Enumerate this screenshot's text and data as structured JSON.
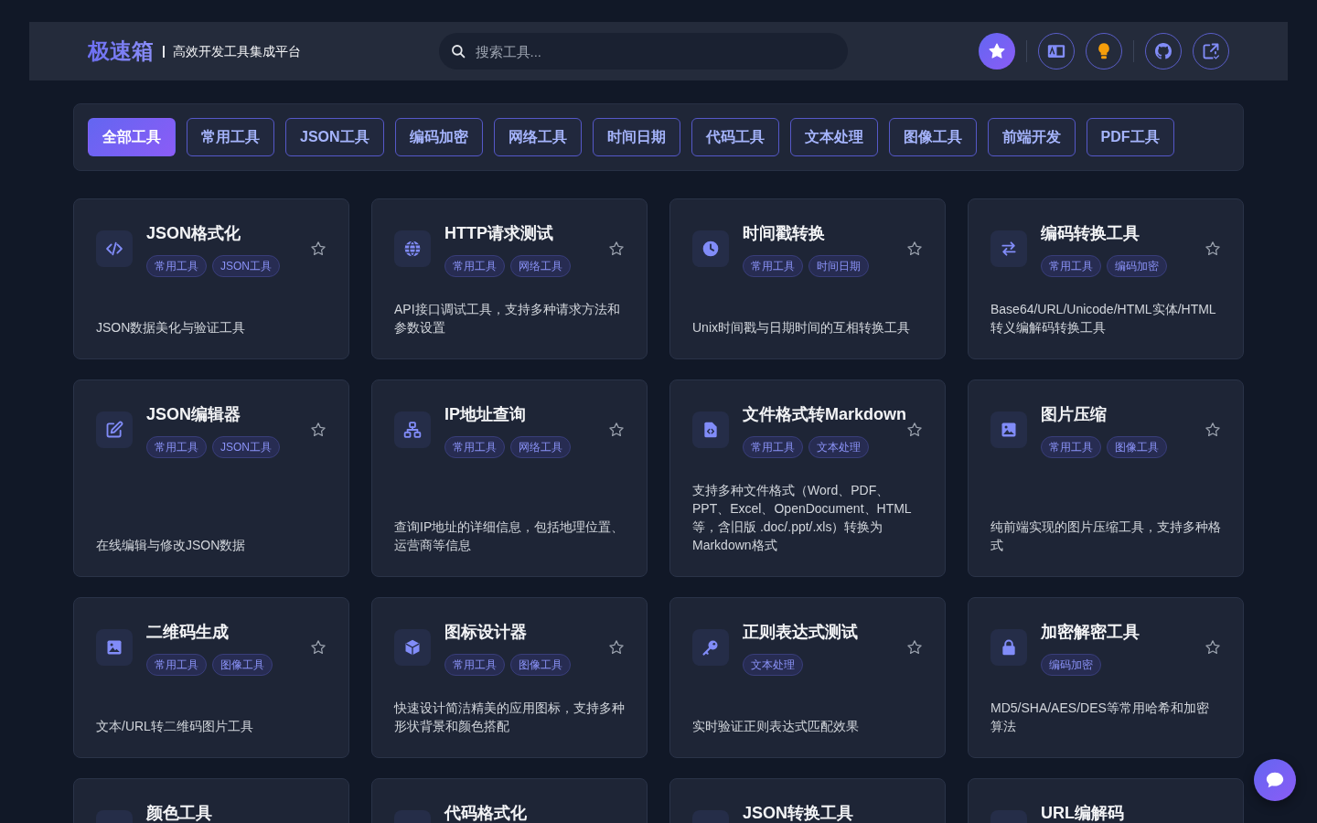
{
  "header": {
    "logo": "极速箱",
    "tagline": "高效开发工具集成平台",
    "search": {
      "placeholder": "搜索工具..."
    },
    "toolbar": [
      {
        "kind": "favorites"
      },
      {
        "kind": "separator"
      },
      {
        "kind": "language"
      },
      {
        "kind": "theme"
      },
      {
        "kind": "separator"
      },
      {
        "kind": "repository"
      },
      {
        "kind": "share"
      }
    ]
  },
  "categories": [
    {
      "label": "全部工具",
      "selected": true
    },
    {
      "label": "常用工具",
      "selected": false
    },
    {
      "label": "JSON工具",
      "selected": false
    },
    {
      "label": "编码加密",
      "selected": false
    },
    {
      "label": "网络工具",
      "selected": false
    },
    {
      "label": "时间日期",
      "selected": false
    },
    {
      "label": "代码工具",
      "selected": false
    },
    {
      "label": "文本处理",
      "selected": false
    },
    {
      "label": "图像工具",
      "selected": false
    },
    {
      "label": "前端开发",
      "selected": false
    },
    {
      "label": "PDF工具",
      "selected": false
    }
  ],
  "tools": [
    {
      "kind": "formatter",
      "title": "JSON格式化",
      "tags": [
        "常用工具",
        "JSON工具"
      ],
      "favorite": false,
      "description": "JSON数据美化与验证工具"
    },
    {
      "kind": "request",
      "title": "HTTP请求测试",
      "tags": [
        "常用工具",
        "网络工具"
      ],
      "favorite": false,
      "description": "API接口调试工具，支持多种请求方法和参数设置"
    },
    {
      "kind": "timestamp",
      "title": "时间戳转换",
      "tags": [
        "常用工具",
        "时间日期"
      ],
      "favorite": false,
      "description": "Unix时间戳与日期时间的互相转换工具"
    },
    {
      "kind": "converter",
      "title": "编码转换工具",
      "tags": [
        "常用工具",
        "编码加密"
      ],
      "favorite": false,
      "description": "Base64/URL/Unicode/HTML实体/HTML转义编解码转换工具"
    },
    {
      "kind": "editor",
      "title": "JSON编辑器",
      "tags": [
        "常用工具",
        "JSON工具"
      ],
      "favorite": false,
      "description": "在线编辑与修改JSON数据"
    },
    {
      "kind": "lookup",
      "title": "IP地址查询",
      "tags": [
        "常用工具",
        "网络工具"
      ],
      "favorite": false,
      "description": "查询IP地址的详细信息，包括地理位置、运营商等信息"
    },
    {
      "kind": "document",
      "title": "文件格式转Markdown",
      "tags": [
        "常用工具",
        "文本处理"
      ],
      "favorite": false,
      "description": "支持多种文件格式（Word、PDF、PPT、Excel、OpenDocument、HTML等，含旧版 .doc/.ppt/.xls）转换为Markdown格式"
    },
    {
      "kind": "image",
      "title": "图片压缩",
      "tags": [
        "常用工具",
        "图像工具"
      ],
      "favorite": false,
      "description": "纯前端实现的图片压缩工具，支持多种格式"
    },
    {
      "kind": "qrcode",
      "title": "二维码生成",
      "tags": [
        "常用工具",
        "图像工具"
      ],
      "favorite": false,
      "description": "文本/URL转二维码图片工具"
    },
    {
      "kind": "designer",
      "title": "图标设计器",
      "tags": [
        "常用工具",
        "图像工具"
      ],
      "favorite": false,
      "description": "快速设计简洁精美的应用图标，支持多种形状背景和颜色搭配"
    },
    {
      "kind": "regex",
      "title": "正则表达式测试",
      "tags": [
        "文本处理"
      ],
      "favorite": false,
      "description": "实时验证正则表达式匹配效果"
    },
    {
      "kind": "crypto",
      "title": "加密解密工具",
      "tags": [
        "编码加密"
      ],
      "favorite": false,
      "description": "MD5/SHA/AES/DES等常用哈希和加密算法"
    },
    {
      "title": "颜色工具"
    },
    {
      "title": "代码格式化"
    },
    {
      "title": "JSON转换工具"
    },
    {
      "title": "URL编解码"
    }
  ],
  "chat": {
    "kind": "chat"
  }
}
